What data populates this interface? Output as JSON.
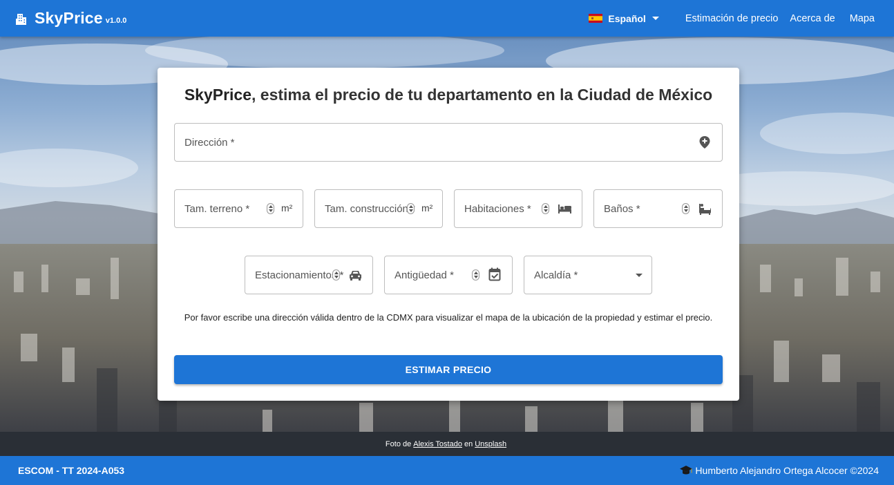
{
  "app": {
    "name": "SkyPrice",
    "version": "v1.0.0"
  },
  "nav": {
    "language": "Español",
    "links": [
      "Estimación de precio",
      "Acerca de",
      "Mapa"
    ]
  },
  "card": {
    "title_brand": "SkyPrice",
    "title_rest": ", estima el precio de tu departamento en la Ciudad de México",
    "fields": {
      "direccion": "Dirección *",
      "terreno": "Tam. terreno *",
      "terreno_unit": "m²",
      "construccion": "Tam. construcción *",
      "construccion_unit": "m²",
      "habitaciones": "Habitaciones *",
      "banos": "Baños *",
      "estacionamientos": "Estacionamientos *",
      "antiguedad": "Antigüedad *",
      "alcaldia": "Alcaldía *"
    },
    "hint": "Por favor escribe una dirección válida dentro de la CDMX para visualizar el mapa de la ubicación de la propiedad y estimar el precio.",
    "button": "ESTIMAR PRECIO"
  },
  "credit": {
    "prefix": "Foto de",
    "author": "Alexis Tostado",
    "middle": "en",
    "site": "Unsplash"
  },
  "footer": {
    "left": "ESCOM - TT 2024-A053",
    "right": "Humberto Alejandro Ortega Alcocer ©2024"
  },
  "colors": {
    "primary": "#1e75d6",
    "card": "#ffffff"
  }
}
